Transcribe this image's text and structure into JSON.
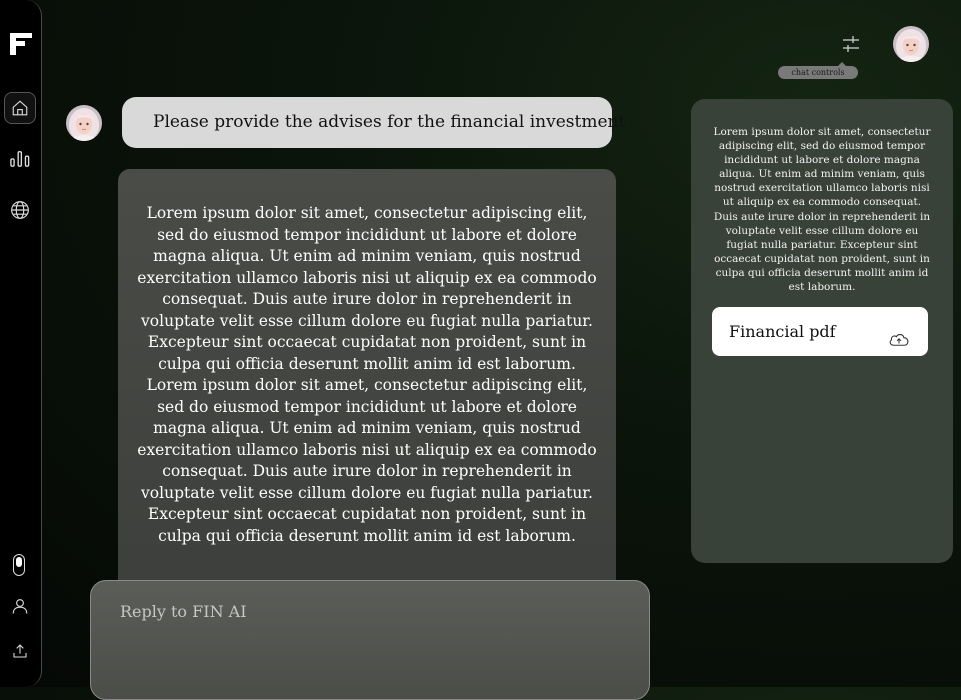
{
  "chat": {
    "user_message": "Please provide the advises for the financial investment",
    "ai_response_paragraphs": [
      "Lorem ipsum dolor sit amet, consectetur adipiscing elit, sed do eiusmod tempor incididunt ut labore et dolore magna aliqua. Ut enim ad minim veniam, quis nostrud exercitation ullamco laboris nisi ut aliquip ex ea commodo consequat. Duis aute irure dolor in reprehenderit in voluptate velit esse cillum dolore eu fugiat nulla pariatur. Excepteur sint occaecat cupidatat non proident, sunt in culpa qui officia deserunt mollit anim id est laborum.",
      "Lorem ipsum dolor sit amet, consectetur adipiscing elit, sed do eiusmod tempor incididunt ut labore et dolore magna aliqua. Ut enim ad minim veniam, quis nostrud exercitation ullamco laboris nisi ut aliquip ex ea commodo consequat. Duis aute irure dolor in reprehenderit in voluptate velit esse cillum dolore eu fugiat nulla pariatur. Excepteur sint occaecat cupidatat non proident, sunt in culpa qui officia deserunt mollit anim id est laborum."
    ],
    "reply_placeholder": "Reply to FIN AI"
  },
  "header": {
    "tooltip": "chat controls"
  },
  "side_panel": {
    "text": "Lorem ipsum dolor sit amet, consectetur adipiscing elit, sed do eiusmod tempor incididunt ut labore et dolore magna aliqua. Ut enim ad minim veniam, quis nostrud exercitation ullamco laboris nisi ut aliquip ex ea commodo consequat. Duis aute irure dolor in reprehenderit in voluptate velit esse cillum dolore eu fugiat nulla pariatur. Excepteur sint occaecat cupidatat non proident, sunt in culpa qui officia deserunt mollit anim id est laborum.",
    "file_label": "Financial pdf"
  },
  "icons": {
    "logo": "logo-icon",
    "home": "home-icon",
    "analytics": "bar-chart-icon",
    "globe": "globe-icon",
    "toggle": "toggle-icon",
    "profile": "user-icon",
    "upload": "upload-icon",
    "controls": "sliders-icon",
    "file_upload": "cloud-upload-icon"
  },
  "colors": {
    "user_bubble": "#d9d9d9",
    "ai_bubble": "#454744",
    "side_panel": "#394239",
    "sidebar": "#000000"
  }
}
